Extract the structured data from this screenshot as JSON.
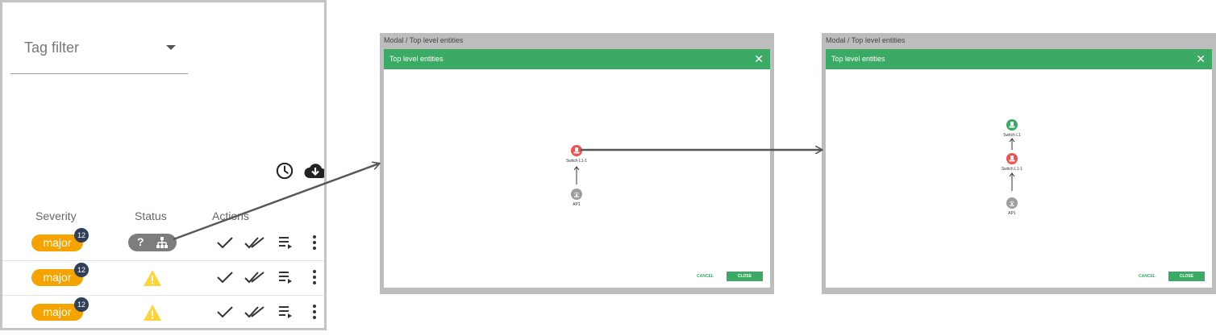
{
  "left_panel": {
    "tag_filter": {
      "label": "Tag filter"
    },
    "columns": {
      "severity": "Severity",
      "status": "Status",
      "actions": "Actions"
    },
    "rows": [
      {
        "severity": "major",
        "count": "12",
        "status_text": "?",
        "status_kind": "unknown-topology"
      },
      {
        "severity": "major",
        "count": "12",
        "status_kind": "warning"
      },
      {
        "severity": "major",
        "count": "12",
        "status_kind": "warning"
      }
    ],
    "icons": {
      "history": "clock-icon",
      "download": "cloud-download-icon",
      "ack": "check-icon",
      "ack_all": "double-check-icon",
      "details": "playlist-icon",
      "more": "more-vert-icon"
    }
  },
  "modal_before": {
    "caption": "Modal / Top level entities",
    "title": "Top level entities",
    "close_glyph": "✕",
    "nodes": {
      "switch": "Switch L1-1",
      "ap": "AP1"
    },
    "buttons": {
      "cancel": "CANCEL",
      "close": "CLOSE"
    }
  },
  "modal_after": {
    "caption": "Modal / Top level entities",
    "title": "Top level entities",
    "close_glyph": "✕",
    "nodes": {
      "top_switch": "Switch L1",
      "switch": "Switch L1-1",
      "ap": "AP1"
    },
    "buttons": {
      "cancel": "CANCEL",
      "close": "CLOSE"
    }
  },
  "colors": {
    "accent_green": "#3aaa64",
    "major_orange": "#f5a300",
    "badge_navy": "#2f3f55",
    "node_red": "#f05050",
    "node_green": "#3aaa64",
    "node_grey": "#9e9e9e",
    "warning_yellow": "#ffd43b"
  }
}
